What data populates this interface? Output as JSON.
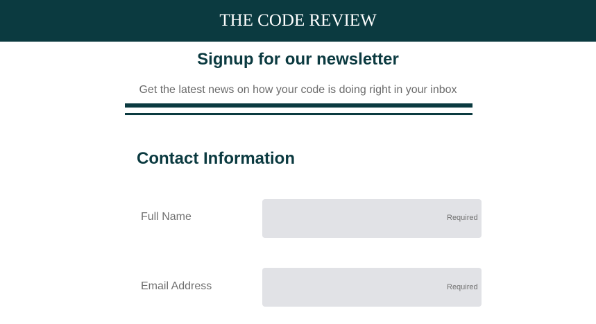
{
  "header": {
    "brand": "THE CODE REVIEW"
  },
  "intro": {
    "title": "Signup for our newsletter",
    "subtitle": "Get the latest news on how your code is doing right in your inbox"
  },
  "contact": {
    "title": "Contact Information",
    "fields": [
      {
        "label": "Full Name",
        "value": "",
        "placeholder": "",
        "hint": "Required"
      },
      {
        "label": "Email Address",
        "value": "",
        "placeholder": "",
        "hint": "Required"
      }
    ]
  },
  "colors": {
    "brand": "#0b3a40",
    "input_bg": "#e1e2e6",
    "muted_text": "#707070"
  }
}
